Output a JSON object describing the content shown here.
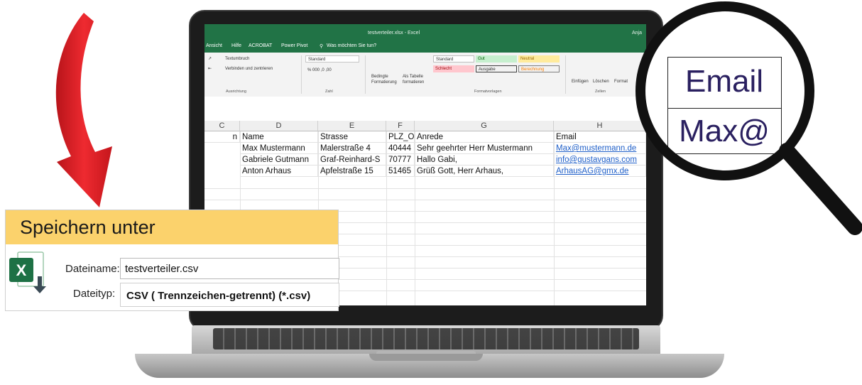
{
  "excel": {
    "title": "testverteiler.xlsx - Excel",
    "user": "Anja",
    "menu": [
      "Ansicht",
      "Hilfe",
      "ACROBAT",
      "Power Pivot",
      "Was möchten Sie tun?"
    ],
    "ribbon": {
      "wrap_text": "Textumbruch",
      "merge": "Verbinden und zentrieren",
      "number_format": "Standard",
      "group_alignment": "Ausrichtung",
      "group_number": "Zahl",
      "conditional": "Bedingte Formatierung",
      "as_table": "Als Tabelle formatieren",
      "group_styles": "Formatvorlagen",
      "group_cells": "Zellen",
      "insert": "Einfügen",
      "delete": "Löschen",
      "format": "Format",
      "styles": {
        "standard": "Standard",
        "gut": "Gut",
        "neutral": "Neutral",
        "schlecht": "Schlecht",
        "ausgabe": "Ausgabe",
        "berechnung": "Berechnung"
      }
    },
    "columns": [
      "C",
      "D",
      "E",
      "F",
      "G",
      "H"
    ],
    "header_row": {
      "c": "n",
      "d": "Name",
      "e": "Strasse",
      "f": "PLZ_Or",
      "g": "Anrede",
      "h": "Email"
    },
    "rows": [
      {
        "d": "Max Mustermann",
        "e": "Malerstraße 4",
        "f": "40444",
        "g": "Sehr geehrter Herr Mustermann",
        "h": "Max@mustermann.de"
      },
      {
        "d": "Gabriele Gutmann",
        "e": "Graf-Reinhard-S",
        "f": "70777",
        "g": "Hallo Gabi,",
        "h": "info@gustavgans.com"
      },
      {
        "d": "Anton Arhaus",
        "e": "Apfelstraße 15",
        "f": "51465",
        "g": "Grüß Gott, Herr Arhaus,",
        "h": "ArhausAG@gmx.de"
      }
    ]
  },
  "dialog": {
    "title": "Speichern unter",
    "filename_label": "Dateiname:",
    "filename_value": "testverteiler.csv",
    "filetype_label": "Dateityp:",
    "filetype_value": "CSV ( Trennzeichen-getrennt) (*.csv)",
    "logo_letter": "X"
  },
  "magnifier": {
    "top": "Email",
    "bottom": "Max@"
  },
  "colors": {
    "excel_green": "#217346",
    "dialog_header": "#fbd26c",
    "arrow_red": "#e8262b",
    "link_blue": "#1f5fc8",
    "magnifier_text": "#2a2060"
  }
}
